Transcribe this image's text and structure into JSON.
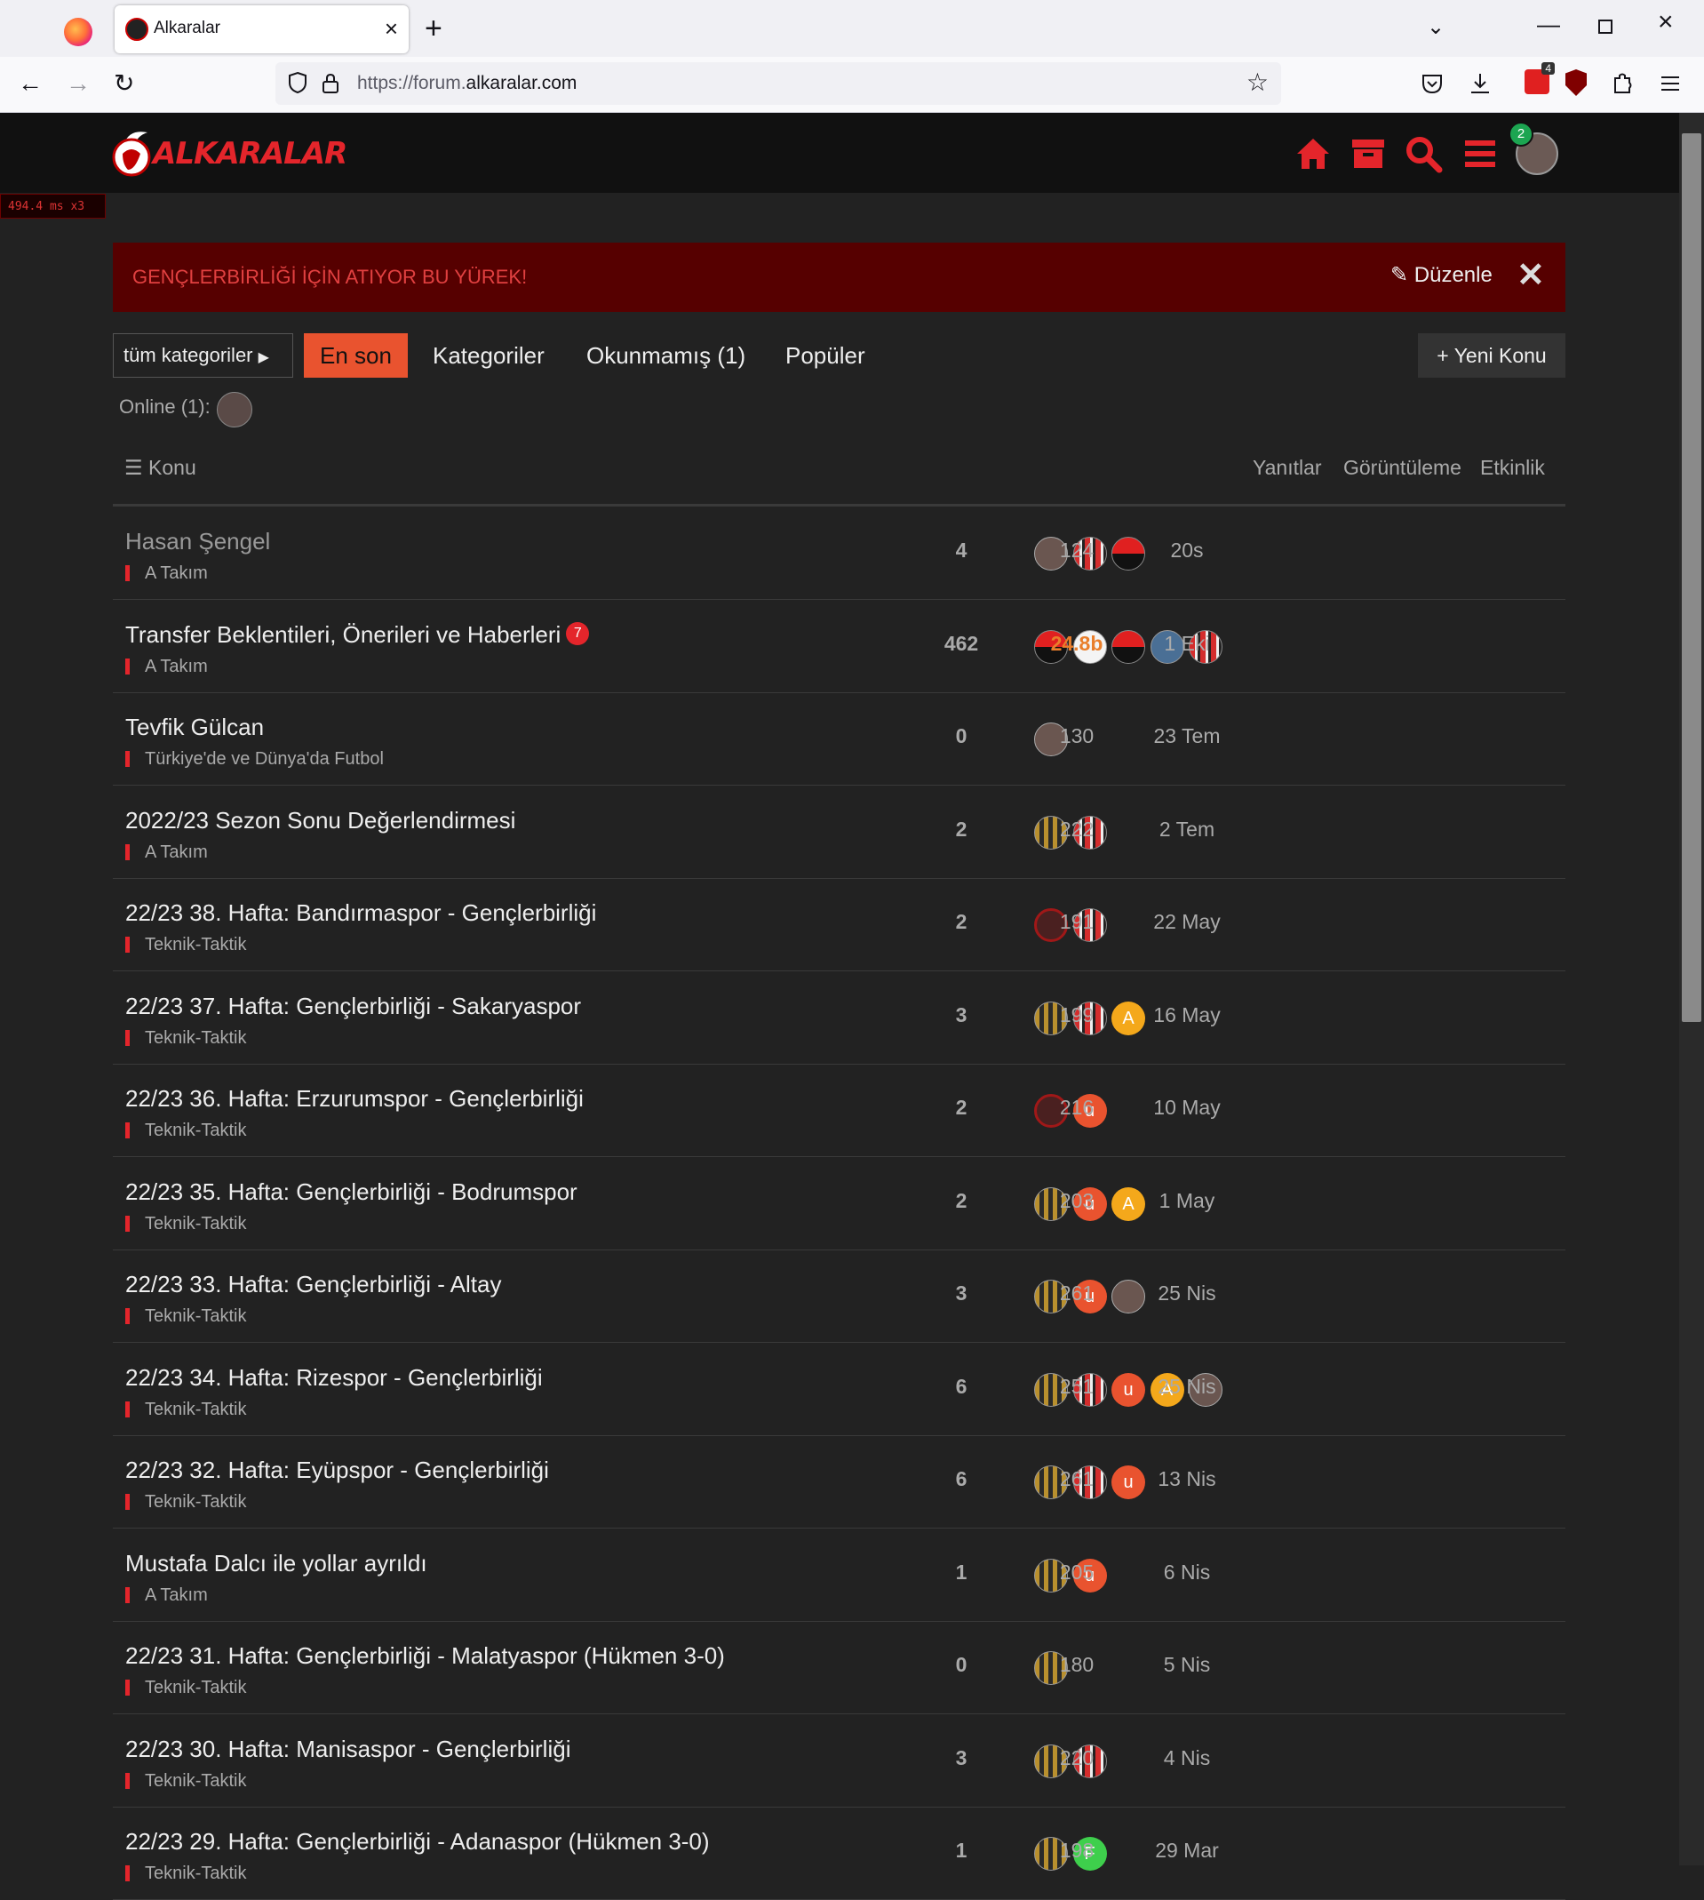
{
  "browser": {
    "tab_title": "Alkaralar",
    "url_prefix": "https://forum.",
    "url_domain": "alkaralar.com",
    "extension_badge": "4"
  },
  "header": {
    "logo_text": "ALKARALAR",
    "notification_count": "2"
  },
  "perf_label": "494.4 ms x3",
  "banner": {
    "text": "GENÇLERBİRLİĞİ İÇİN ATIYOR BU YÜREK!",
    "edit_label": "Düzenle",
    "close_glyph": "✕"
  },
  "nav": {
    "category_dropdown": "tüm kategoriler",
    "items": [
      "En son",
      "Kategoriler",
      "Okunmamış (1)",
      "Popüler"
    ],
    "new_topic": "Yeni Konu",
    "online_label": "Online (1):"
  },
  "table": {
    "headers": {
      "topic": "Konu",
      "replies": "Yanıtlar",
      "views": "Görüntüleme",
      "activity": "Etkinlik"
    },
    "rows": [
      {
        "title": "Hasan Şengel",
        "category": "A Takım",
        "replies": "4",
        "views": "124",
        "activity": "20s",
        "seen": true,
        "posters": [
          "photo",
          "stripe",
          "halfred"
        ]
      },
      {
        "title": "Transfer Beklentileri, Önerileri ve Haberleri",
        "unread": "7",
        "category": "A Takım",
        "replies": "462",
        "views": "24.8b",
        "views_hot": true,
        "activity": "1 Eki",
        "posters": [
          "halfred",
          "white",
          "halfred",
          "blue",
          "stripe"
        ]
      },
      {
        "title": "Tevfik Gülcan",
        "category": "Türkiye'de ve Dünya'da Futbol",
        "replies": "0",
        "views": "130",
        "activity": "23 Tem",
        "posters": [
          "photo"
        ]
      },
      {
        "title": "2022/23 Sezon Sonu Değerlendirmesi",
        "category": "A Takım",
        "replies": "2",
        "views": "222",
        "activity": "2 Tem",
        "posters": [
          "gold",
          "stripe"
        ]
      },
      {
        "title": "22/23 38. Hafta: Bandırmaspor - Gençlerbirliği",
        "category": "Teknik-Taktik",
        "replies": "2",
        "views": "191",
        "activity": "22 May",
        "posters": [
          "ring",
          "stripe"
        ]
      },
      {
        "title": "22/23 37. Hafta: Gençlerbirliği - Sakaryaspor",
        "category": "Teknik-Taktik",
        "replies": "3",
        "views": "199",
        "activity": "16 May",
        "posters": [
          "gold",
          "stripe",
          "a:A"
        ]
      },
      {
        "title": "22/23 36. Hafta: Erzurumspor - Gençlerbirliği",
        "category": "Teknik-Taktik",
        "replies": "2",
        "views": "216",
        "activity": "10 May",
        "posters": [
          "ring",
          "u:u"
        ]
      },
      {
        "title": "22/23 35. Hafta: Gençlerbirliği - Bodrumspor",
        "category": "Teknik-Taktik",
        "replies": "2",
        "views": "203",
        "activity": "1 May",
        "posters": [
          "gold",
          "u:u",
          "a:A"
        ]
      },
      {
        "title": "22/23 33. Hafta: Gençlerbirliği - Altay",
        "category": "Teknik-Taktik",
        "replies": "3",
        "views": "261",
        "activity": "25 Nis",
        "posters": [
          "gold",
          "u:u",
          "photo"
        ]
      },
      {
        "title": "22/23 34. Hafta: Rizespor - Gençlerbirliği",
        "category": "Teknik-Taktik",
        "replies": "6",
        "views": "251",
        "activity": "25 Nis",
        "posters": [
          "gold",
          "stripe",
          "u:u",
          "a:A",
          "photo"
        ]
      },
      {
        "title": "22/23 32. Hafta: Eyüpspor - Gençlerbirliği",
        "category": "Teknik-Taktik",
        "replies": "6",
        "views": "261",
        "activity": "13 Nis",
        "posters": [
          "gold",
          "stripe",
          "u:u"
        ]
      },
      {
        "title": "Mustafa Dalcı ile yollar ayrıldı",
        "category": "A Takım",
        "replies": "1",
        "views": "205",
        "activity": "6 Nis",
        "posters": [
          "gold",
          "u:u"
        ]
      },
      {
        "title": "22/23 31. Hafta: Gençlerbirliği - Malatyaspor (Hükmen 3-0)",
        "category": "Teknik-Taktik",
        "replies": "0",
        "views": "180",
        "activity": "5 Nis",
        "posters": [
          "gold"
        ]
      },
      {
        "title": "22/23 30. Hafta: Manisaspor - Gençlerbirliği",
        "category": "Teknik-Taktik",
        "replies": "3",
        "views": "220",
        "activity": "4 Nis",
        "posters": [
          "gold",
          "stripe"
        ]
      },
      {
        "title": "22/23 29. Hafta: Gençlerbirliği - Adanaspor (Hükmen 3-0)",
        "category": "Teknik-Taktik",
        "replies": "1",
        "views": "198",
        "activity": "29 Mar",
        "posters": [
          "gold",
          "f:F"
        ]
      }
    ]
  },
  "colors": {
    "brand_red": "#e4252b",
    "active_nav": "#e9532f",
    "banner_bg": "#560000",
    "hot_views": "#e97e2b",
    "page_bg": "#222222"
  }
}
